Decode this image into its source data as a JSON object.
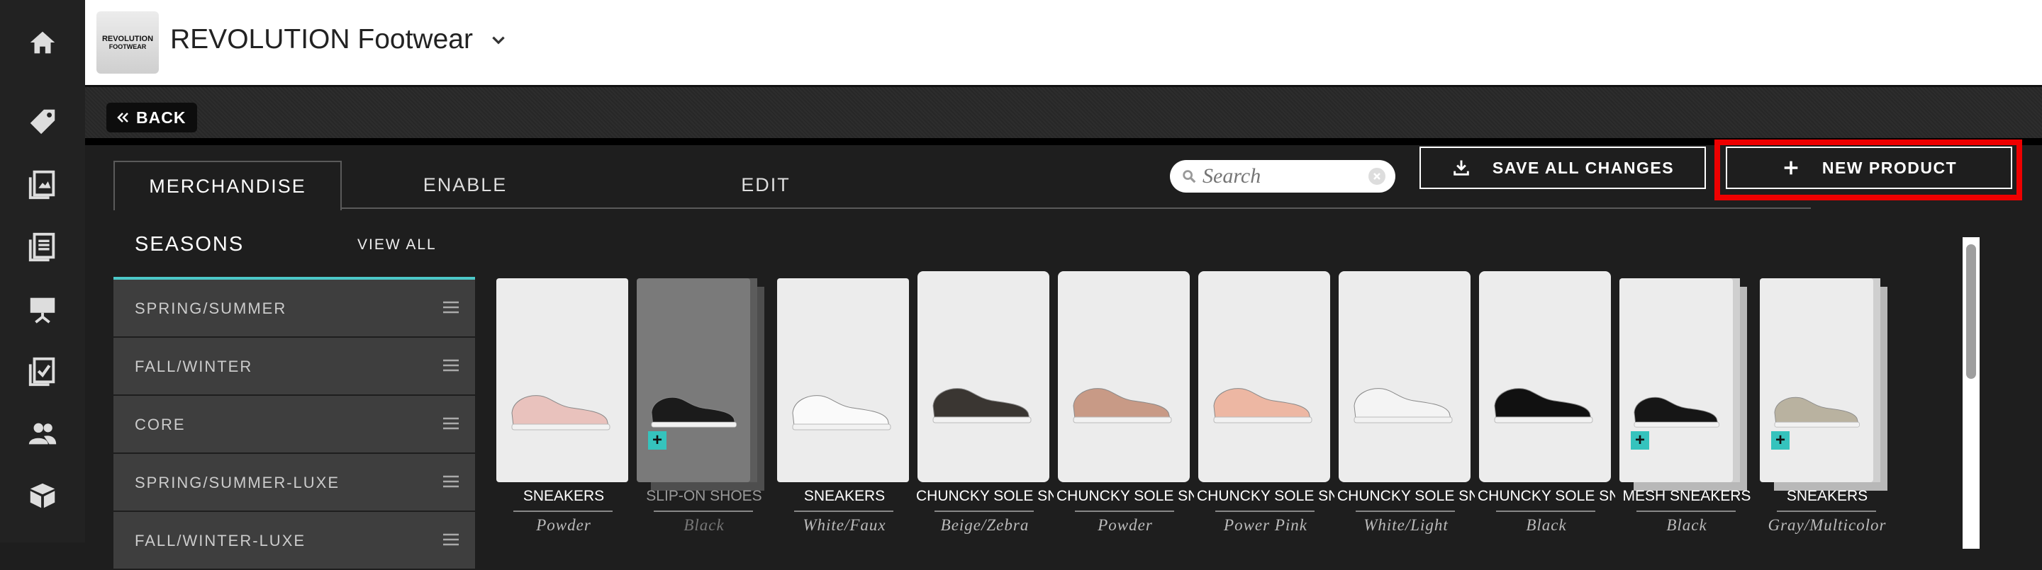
{
  "brand": {
    "logo_line1": "REVOLUTION",
    "logo_line2": "FOOTWEAR",
    "name": "REVOLUTION Footwear"
  },
  "sidebar": {
    "icons": [
      "home-icon",
      "tag-icon",
      "catalog-icon",
      "list-icon",
      "presentation-icon",
      "checklist-icon",
      "users-icon",
      "box-icon"
    ]
  },
  "back": {
    "label": "BACK"
  },
  "tabs": [
    {
      "label": "MERCHANDISE",
      "active": true
    },
    {
      "label": "ENABLE",
      "active": false
    },
    {
      "label": "EDIT",
      "active": false
    }
  ],
  "search": {
    "placeholder": "Search"
  },
  "actions": {
    "save_label": "SAVE ALL CHANGES",
    "new_label": "NEW PRODUCT"
  },
  "seasons": {
    "title": "SEASONS",
    "view_all": "VIEW ALL",
    "items": [
      "SPRING/SUMMER",
      "FALL/WINTER",
      "CORE",
      "SPRING/SUMMER-LUXE",
      "FALL/WINTER-LUXE"
    ]
  },
  "products": [
    {
      "category": "SNEAKERS",
      "color": "Powder",
      "shoe_color": "#e9c2bd",
      "dimmed": false,
      "stacked": false,
      "raised": false,
      "badge": false
    },
    {
      "category": "SLIP-ON SHOES",
      "color": "Black",
      "shoe_color": "#1b1b1b",
      "dimmed": true,
      "stacked": true,
      "raised": false,
      "badge": true
    },
    {
      "category": "SNEAKERS",
      "color": "White/Faux",
      "shoe_color": "#fafafa",
      "dimmed": false,
      "stacked": false,
      "raised": false,
      "badge": false
    },
    {
      "category": "CHUNCKY SOLE SNEAKERS",
      "color": "Beige/Zebra",
      "shoe_color": "#3a3632",
      "dimmed": false,
      "stacked": false,
      "raised": true,
      "badge": false
    },
    {
      "category": "CHUNCKY SOLE SNEAKERS",
      "color": "Powder",
      "shoe_color": "#c89a86",
      "dimmed": false,
      "stacked": false,
      "raised": true,
      "badge": false
    },
    {
      "category": "CHUNCKY SOLE SNEAKERS",
      "color": "Power Pink",
      "shoe_color": "#edb7a3",
      "dimmed": false,
      "stacked": false,
      "raised": true,
      "badge": false
    },
    {
      "category": "CHUNCKY SOLE SNEAKERS",
      "color": "White/Light",
      "shoe_color": "#f4f4f4",
      "dimmed": false,
      "stacked": false,
      "raised": true,
      "badge": false
    },
    {
      "category": "CHUNCKY SOLE SNEAKERS",
      "color": "Black",
      "shoe_color": "#111111",
      "dimmed": false,
      "stacked": false,
      "raised": true,
      "badge": false
    },
    {
      "category": "MESH SNEAKERS",
      "color": "Black",
      "shoe_color": "#161616",
      "dimmed": false,
      "stacked": true,
      "raised": false,
      "badge": true
    },
    {
      "category": "SNEAKERS",
      "color": "Gray/Multicolor",
      "shoe_color": "#b9b2a0",
      "dimmed": false,
      "stacked": true,
      "raised": false,
      "badge": true
    }
  ]
}
